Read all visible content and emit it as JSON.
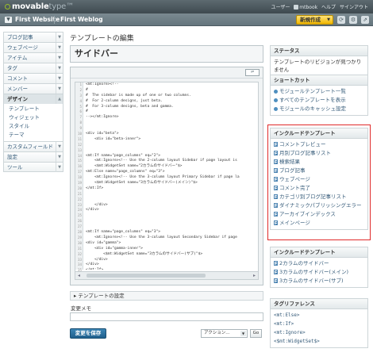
{
  "header": {
    "logo_main": "movable",
    "logo_sub": "type",
    "logo_suffix": "™",
    "user_links": [
      "ユーザー",
      "mtbook",
      "ヘルプ",
      "サインアウト"
    ]
  },
  "context": {
    "site": "First Website",
    "blog": "First Weblog",
    "new_button": "新規作成",
    "icons": [
      "refresh-icon",
      "settings-icon",
      "view-site-icon"
    ]
  },
  "nav": [
    {
      "label": "ブログ記事",
      "expanded": false
    },
    {
      "label": "ウェブページ",
      "expanded": false
    },
    {
      "label": "アイテム",
      "expanded": false
    },
    {
      "label": "タグ",
      "expanded": false
    },
    {
      "label": "コメント",
      "expanded": false
    },
    {
      "label": "メンバー",
      "expanded": false
    },
    {
      "label": "デザイン",
      "expanded": true,
      "children": [
        "テンプレート",
        "ウィジェット",
        "スタイル",
        "テーマ"
      ]
    },
    {
      "label": "カスタムフィールド",
      "expanded": false
    },
    {
      "label": "設定",
      "expanded": false
    },
    {
      "label": "ツール",
      "expanded": false
    }
  ],
  "main": {
    "page_title": "テンプレートの編集",
    "template_name": "サイドバー",
    "wrap_toggle": "⇌",
    "code_lines": [
      "<mt:Ignore><!--",
      "#",
      "#  The sidebar is made up of one or two columns.",
      "#  For 2-column designs, just beta.",
      "#  For 3-column designs, beta and gamma.",
      "#",
      "--></mt:Ignore>",
      "",
      "",
      "<div id=\"beta\">",
      "    <div id=\"beta-inner\">",
      "",
      "",
      "<mt:If name=\"page_columns\" eq=\"2\">",
      "    <mt:Ignore><!-- Use the 2-column layout Sidebar if page layout is",
      "    <$mt:WidgetSet name=\"2カラムのサイドバー\"$>",
      "<mt:Else name=\"page_columns\" eq=\"3\">",
      "    <mt:Ignore><!-- Use the 3-column layout Primary Sidebar if page la",
      "    <$mt:WidgetSet name=\"3カラムのサイドバー(メイン)\"$>",
      "</mt:If>",
      "",
      "",
      "    </div>",
      "</div>",
      "",
      "",
      "",
      "<mt:If name=\"page_columns\" eq=\"3\">",
      "    <mt:Ignore><!-- Use the 3-column layout Secondary Sidebar if page",
      "<div id=\"gamma\">",
      "    <div id=\"gamma-inner\">",
      "        <$mt:WidgetSet name=\"3カラムのサイドバー(サブ)\"$>",
      "    </div>",
      "</div>",
      "</mt:If>"
    ],
    "settings_label": "▸ テンプレートの設定",
    "memo_label": "変更メモ",
    "save_label": "変更を保存",
    "action_select": "アクション...",
    "go_label": "Go"
  },
  "sidebar": {
    "status": {
      "title": "ステータス",
      "text": "テンプレートのリビジョンが見つかりません"
    },
    "shortcuts": {
      "title": "ショートカット",
      "items": [
        "モジュールテンプレート一覧",
        "すべてのテンプレートを表示",
        "モジュールのキャッシュ設定"
      ]
    },
    "included": {
      "title": "インクルードテンプレート",
      "items": [
        "コメントプレビュー",
        "月別ブログ記事リスト",
        "検索結果",
        "ブログ記事",
        "ウェブページ",
        "コメント完了",
        "カテゴリ別ブログ記事リスト",
        "ダイナミックパブリッシングエラー",
        "アーカイブインデックス",
        "メインページ"
      ]
    },
    "widgets": {
      "title": "インクルードテンプレート",
      "items": [
        "2カラムのサイドバー",
        "3カラムのサイドバー(メイン)",
        "3カラムのサイドバー(サブ)"
      ]
    },
    "tags": {
      "title": "タグリファレンス",
      "items": [
        "<mt:Else>",
        "<mt:If>",
        "<mt:Ignore>",
        "<$mt:WidgetSet$>"
      ]
    }
  }
}
